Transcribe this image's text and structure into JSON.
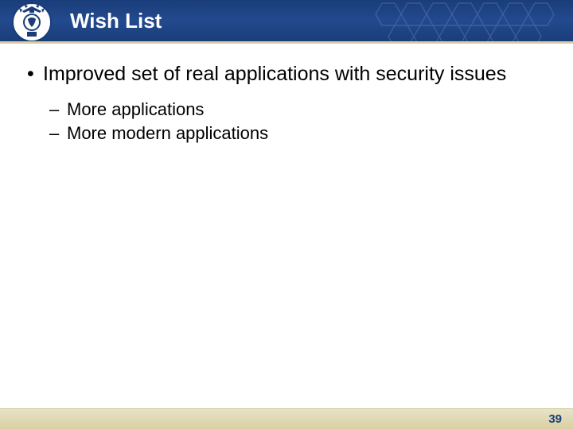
{
  "header": {
    "title": "Wish List"
  },
  "content": {
    "bullets": [
      {
        "text": "Improved set of real applications with security issues",
        "sub": [
          "More applications",
          "More modern applications"
        ]
      }
    ]
  },
  "footer": {
    "page_number": "39"
  },
  "colors": {
    "header_bg": "#1f4489",
    "footer_bg": "#d9cfa3",
    "accent": "#1a3d7a"
  }
}
